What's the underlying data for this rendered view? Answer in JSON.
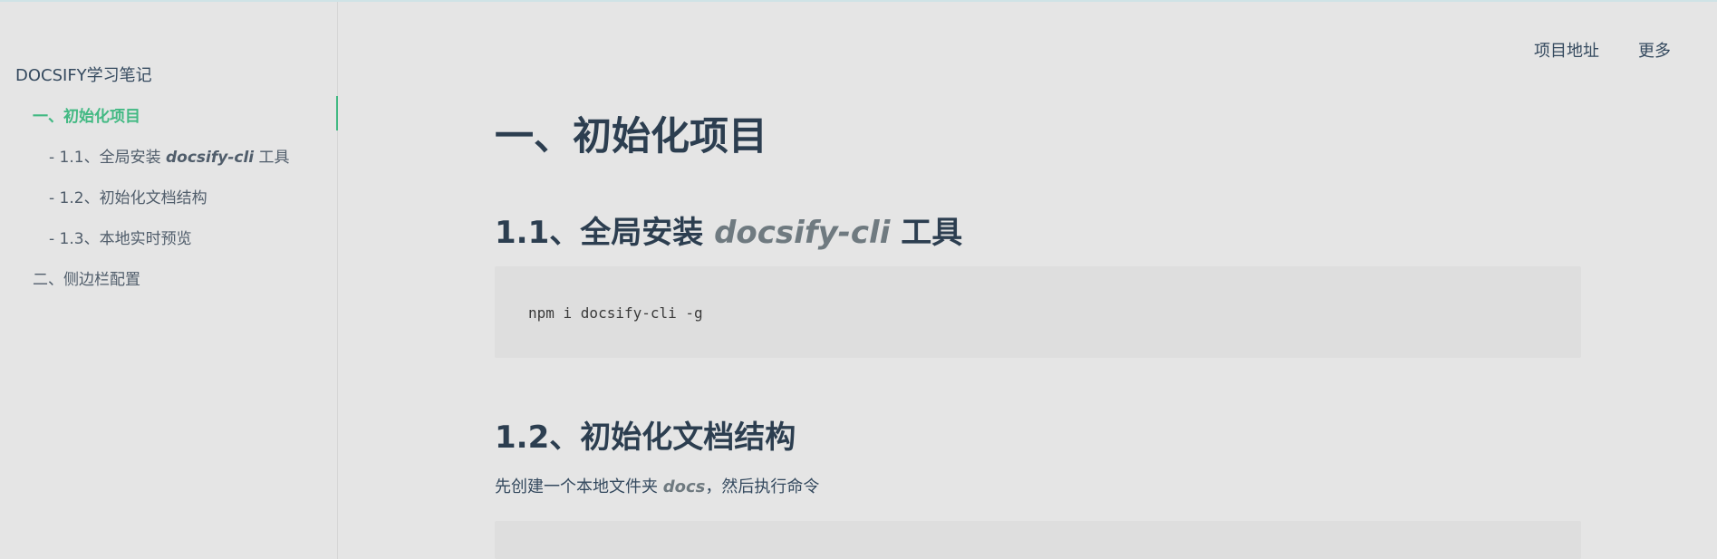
{
  "app": {
    "name": "DOCSIFY学习笔记"
  },
  "sidebar": {
    "items": [
      {
        "label": "一、初始化项目",
        "active": true
      },
      {
        "prefix": "- 1.1、全局安装 ",
        "emph": "docsify-cli",
        "suffix": " 工具"
      },
      {
        "label": "- 1.2、初始化文档结构"
      },
      {
        "label": "- 1.3、本地实时预览"
      },
      {
        "label": "二、侧边栏配置"
      }
    ]
  },
  "topnav": {
    "items": [
      "项目地址",
      "更多"
    ]
  },
  "content": {
    "h1": "一、初始化项目",
    "section1": {
      "prefix": "1.1、全局安装 ",
      "emph": "docsify-cli",
      "suffix": " 工具",
      "code": "npm i docsify-cli -g"
    },
    "section2": {
      "title": "1.2、初始化文档结构",
      "para_prefix": "先创建一个本地文件夹 ",
      "para_emph": "docs",
      "para_suffix": "，然后执行命令"
    }
  },
  "colors": {
    "background": "#e5e5e5",
    "accent": "#42b983",
    "text": "#34495e",
    "code_bg": "#dedede"
  }
}
